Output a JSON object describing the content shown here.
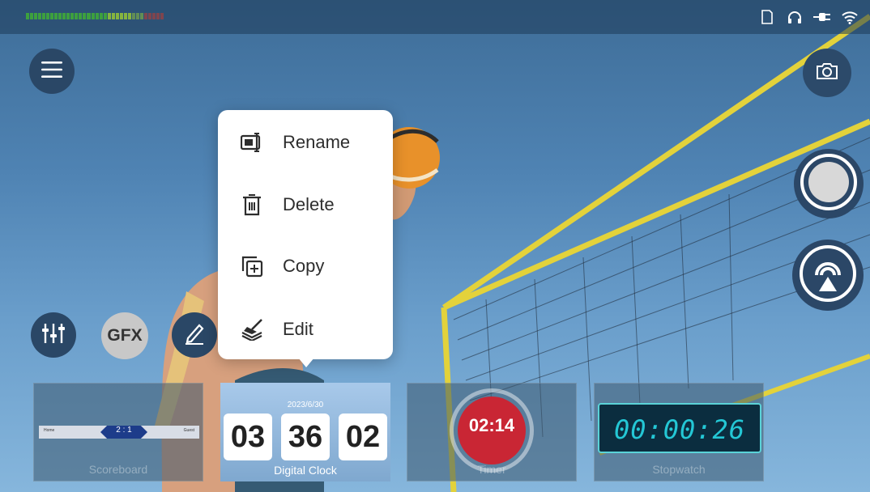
{
  "top_bar": {
    "audio_meter_colors": {
      "low": "#3fa838",
      "mid": "#8fbf3a",
      "high": "#c33a2e"
    },
    "status_icons": [
      "sd-card-icon",
      "headphones-icon",
      "power-plug-icon",
      "wifi-icon"
    ]
  },
  "left_controls": [
    "menu-icon",
    "mixer-icon",
    "gfx-button",
    "pen-icon"
  ],
  "gfx_label": "GFX",
  "right_controls": [
    "camera-icon",
    "record-icon",
    "broadcast-icon"
  ],
  "context_menu": {
    "items": [
      {
        "label": "Rename",
        "icon": "rename-icon"
      },
      {
        "label": "Delete",
        "icon": "trash-icon"
      },
      {
        "label": "Copy",
        "icon": "copy-icon"
      },
      {
        "label": "Edit",
        "icon": "edit-layers-icon"
      }
    ]
  },
  "overlay_cards": {
    "scoreboard": {
      "label": "Scoreboard",
      "score": "2 : 1"
    },
    "digital_clock": {
      "label": "Digital Clock",
      "date": "2023/6/30",
      "hours": "03",
      "minutes": "36",
      "seconds": "02"
    },
    "timer": {
      "label": "Timer",
      "value": "02:14"
    },
    "stopwatch": {
      "label": "Stopwatch",
      "value": "00:00:26"
    }
  },
  "colors": {
    "timer_red": "#c92634",
    "stopwatch_cyan": "#24c7d5",
    "button_dark": "#2a4766"
  }
}
